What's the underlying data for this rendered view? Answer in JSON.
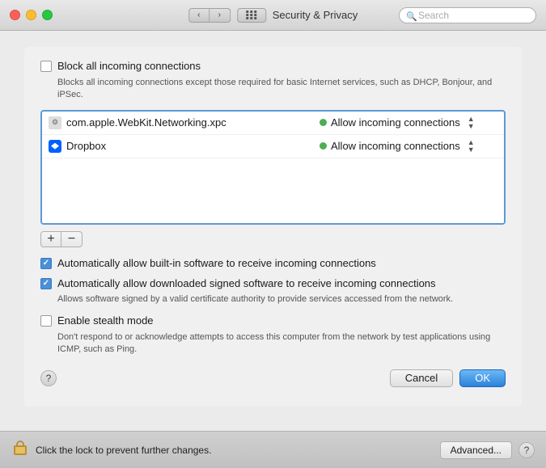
{
  "titlebar": {
    "title": "Security & Privacy",
    "search_placeholder": "Search"
  },
  "block_connections": {
    "label": "Block all incoming connections",
    "sublabel": "Blocks all incoming connections except those required for basic Internet services, such as DHCP, Bonjour, and iPSec.",
    "checked": false
  },
  "app_list": {
    "items": [
      {
        "name": "com.apple.WebKit.Networking.xpc",
        "icon_type": "generic",
        "permission": "Allow incoming connections"
      },
      {
        "name": "Dropbox",
        "icon_type": "dropbox",
        "permission": "Allow incoming connections"
      }
    ]
  },
  "add_button": "+",
  "remove_button": "−",
  "auto_builtin": {
    "label": "Automatically allow built-in software to receive incoming connections",
    "checked": true
  },
  "auto_signed": {
    "label": "Automatically allow downloaded signed software to receive incoming connections",
    "sublabel": "Allows software signed by a valid certificate authority to provide services accessed from the network.",
    "checked": true
  },
  "stealth_mode": {
    "label": "Enable stealth mode",
    "sublabel": "Don't respond to or acknowledge attempts to access this computer from the network by test applications using ICMP, such as Ping.",
    "checked": false
  },
  "buttons": {
    "cancel": "Cancel",
    "ok": "OK",
    "advanced": "Advanced...",
    "help": "?"
  },
  "bottom_bar": {
    "lock_text": "Click the lock to prevent further changes."
  }
}
